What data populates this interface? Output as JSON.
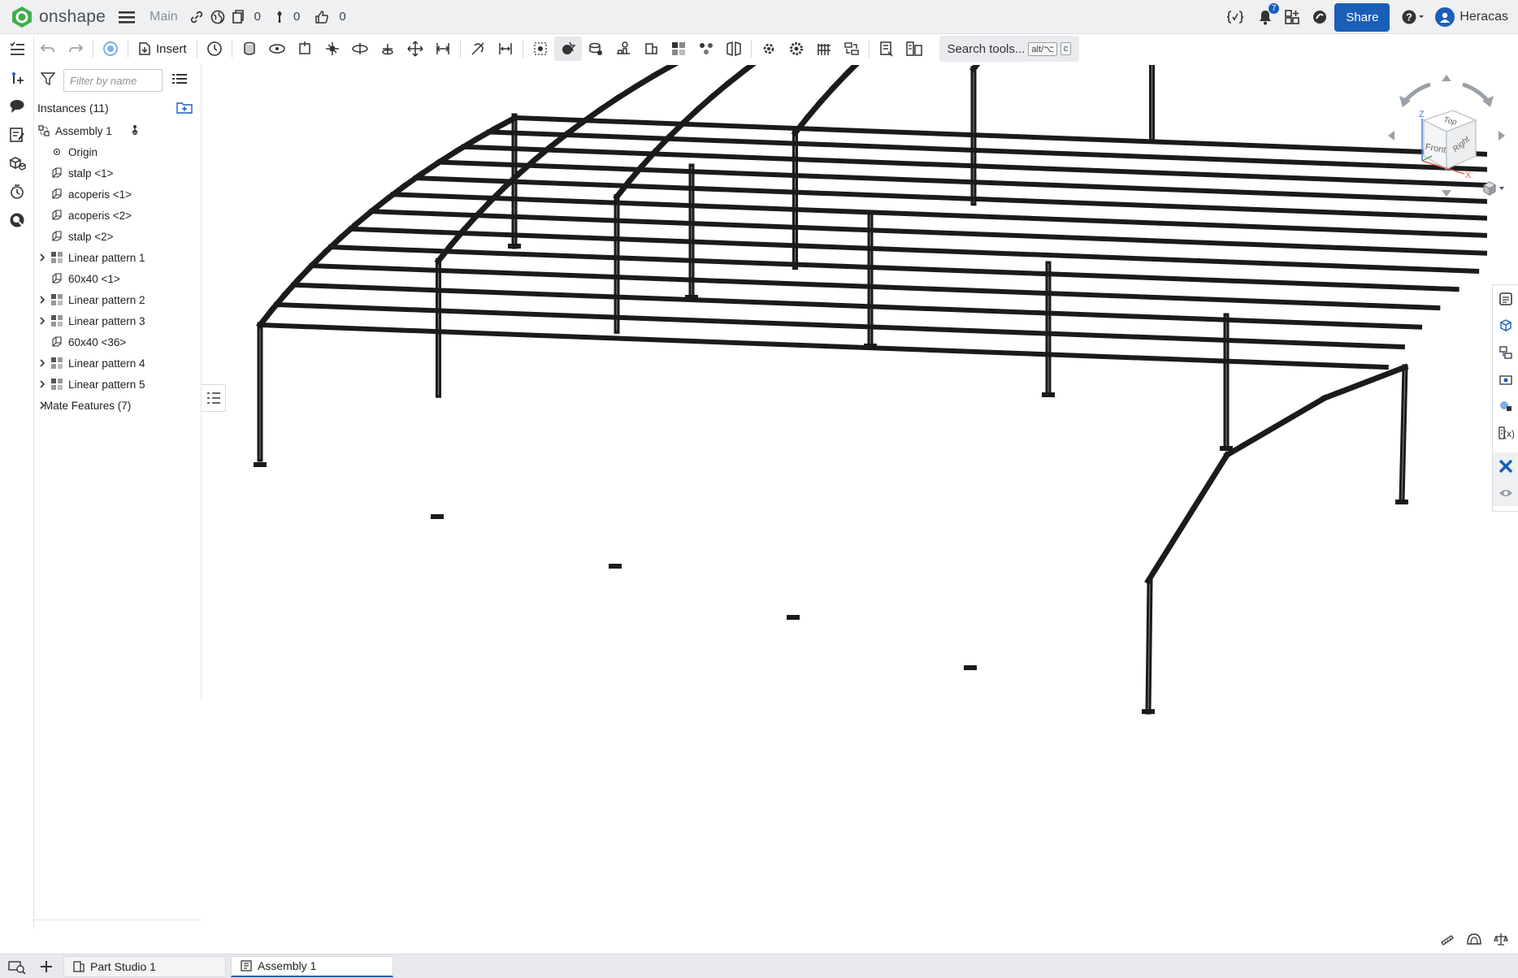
{
  "app": {
    "name": "onshape",
    "branch": "Main",
    "counts": {
      "versions": "0",
      "branches": "0",
      "likes": "0"
    },
    "notifications": "7",
    "share_label": "Share",
    "user": "Heracas"
  },
  "toolbar": {
    "insert_label": "Insert",
    "search_label": "Search tools...",
    "search_kbd_1": "alt/⌥",
    "search_kbd_2": "c"
  },
  "tree": {
    "filter_placeholder": "Filter by name",
    "instances_title": "Instances (11)",
    "items": [
      {
        "label": "Assembly 1",
        "icon": "assembly-icon",
        "expandable": false,
        "indent": 0
      },
      {
        "label": "Origin",
        "icon": "origin-icon",
        "expandable": false,
        "indent": 1
      },
      {
        "label": "stalp <1>",
        "icon": "part-icon",
        "expandable": false,
        "indent": 1
      },
      {
        "label": "acoperis <1>",
        "icon": "part-icon",
        "expandable": false,
        "indent": 1
      },
      {
        "label": "acoperis <2>",
        "icon": "part-icon",
        "expandable": false,
        "indent": 1
      },
      {
        "label": "stalp <2>",
        "icon": "part-icon",
        "expandable": false,
        "indent": 1
      },
      {
        "label": "Linear pattern 1",
        "icon": "linear-pattern-icon",
        "expandable": true,
        "indent": 1
      },
      {
        "label": "60x40 <1>",
        "icon": "part-icon",
        "expandable": false,
        "indent": 1
      },
      {
        "label": "Linear pattern 2",
        "icon": "linear-pattern-icon",
        "expandable": true,
        "indent": 1
      },
      {
        "label": "Linear pattern 3",
        "icon": "linear-pattern-icon",
        "expandable": true,
        "indent": 1
      },
      {
        "label": "60x40 <36>",
        "icon": "part-icon",
        "expandable": false,
        "indent": 1
      },
      {
        "label": "Linear pattern 4",
        "icon": "linear-pattern-icon",
        "expandable": true,
        "indent": 1
      },
      {
        "label": "Linear pattern 5",
        "icon": "linear-pattern-icon",
        "expandable": true,
        "indent": 1
      },
      {
        "label": "Mate Features (7)",
        "icon": "",
        "expandable": true,
        "indent": 0
      }
    ]
  },
  "viewcube": {
    "top": "Top",
    "front": "Front",
    "right": "Right",
    "axis_z": "Z",
    "axis_x": "X"
  },
  "tabs": [
    {
      "label": "Part Studio 1",
      "icon": "part-studio-icon",
      "active": false
    },
    {
      "label": "Assembly 1",
      "icon": "assembly-tab-icon",
      "active": true
    }
  ],
  "colors": {
    "accent": "#1a5eb8",
    "brand_green": "#3fae49",
    "topbar_bg": "#eef0f2",
    "structure": "#1b1b1b"
  }
}
